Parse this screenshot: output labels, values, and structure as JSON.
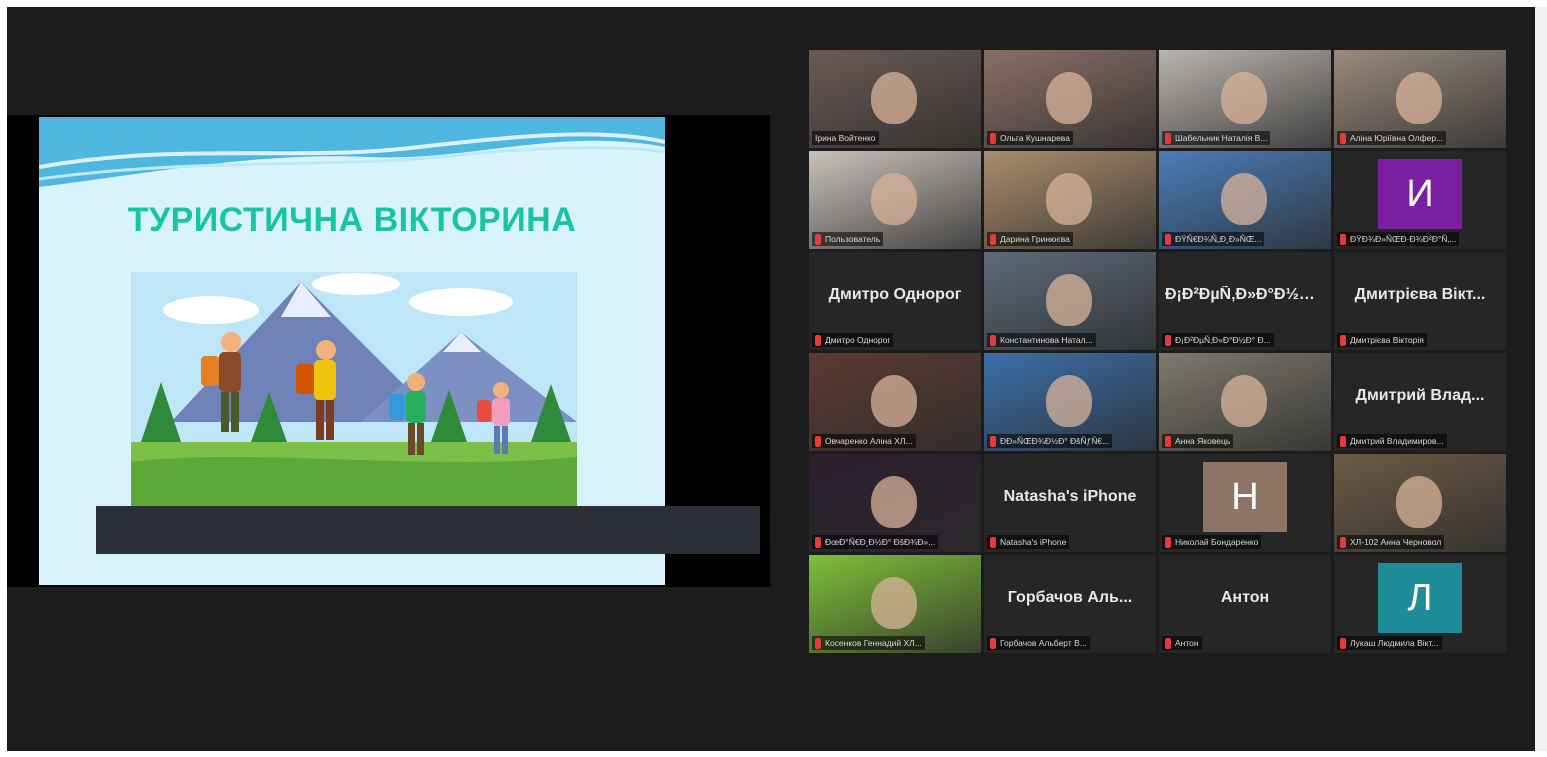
{
  "slide": {
    "title": "ТУРИСТИЧНА ВІКТОРИНА"
  },
  "participants": [
    {
      "label": "Ірина Войтенко",
      "muted": false,
      "active": true,
      "view": "video",
      "tone": "#6b5a55"
    },
    {
      "label": "Ольга Кушнарева",
      "muted": true,
      "view": "video",
      "tone": "#8a6f66"
    },
    {
      "label": "Шабельник Наталія В...",
      "muted": true,
      "view": "video",
      "tone": "#b9b4ae"
    },
    {
      "label": "Аліна Юріївна Олфер...",
      "muted": true,
      "view": "video",
      "tone": "#9a8a7c"
    },
    {
      "label": "Пользователь",
      "muted": true,
      "view": "video",
      "tone": "#c9c2bb"
    },
    {
      "label": "Дарина Гринюєва",
      "muted": true,
      "view": "video",
      "tone": "#a98d6d"
    },
    {
      "label": "ÐŸÑ€Ð¾Ñ„Ð¸Ð»ÑŒ...",
      "muted": true,
      "view": "video",
      "tone": "#4a7db8"
    },
    {
      "label": "ÐŸÐ¾Ð»ÑŒÐ·Ð¾Ð²Ð°Ñ‚...",
      "muted": true,
      "view": "avatar",
      "initial": "И",
      "avatar_color": "#7b1fa2"
    },
    {
      "label": "Дмитро Однорог",
      "muted": true,
      "view": "name",
      "display_name": "Дмитро Однорог"
    },
    {
      "label": "Константинова Натал...",
      "muted": true,
      "view": "video",
      "tone": "#5c6a78"
    },
    {
      "label": "Ð¡Ð²ÐµÑ‚Ð»Ð°Ð½Ð° Ð...",
      "muted": true,
      "view": "name",
      "display_name": "Ð¡Ð²ÐµÑ‚Ð»Ð°Ð½Ð° Ð..."
    },
    {
      "label": "Дмитрієва Вікторія",
      "muted": true,
      "view": "name",
      "display_name": "Дмитрієва Вікт..."
    },
    {
      "label": "Овчаренко Аліна ХЛ...",
      "muted": true,
      "view": "video",
      "tone": "#5b3b32"
    },
    {
      "label": "ÐÐ»ÑŒÐ¾Ð½Ð° ÐšÑƒÑ€...",
      "muted": true,
      "view": "video",
      "tone": "#3b6fa8"
    },
    {
      "label": "Анна Яковець",
      "muted": true,
      "view": "video",
      "tone": "#7d7a6c"
    },
    {
      "label": "Дмитрий Владимиров...",
      "muted": true,
      "view": "name",
      "display_name": "Дмитрий Влад..."
    },
    {
      "label": "ÐœÐ°Ñ€Ð¸Ð½Ð° ÐšÐ¾Ð»...",
      "muted": true,
      "view": "video",
      "tone": "#2a1f2d"
    },
    {
      "label": "Natasha's iPhone",
      "muted": true,
      "view": "name",
      "display_name": "Natasha's iPhone"
    },
    {
      "label": "Николай Бондаренко",
      "muted": true,
      "view": "avatar",
      "initial": "Н",
      "avatar_color": "#8d7465"
    },
    {
      "label": "ХЛ-102 Анна Черновол",
      "muted": true,
      "view": "video",
      "tone": "#6b5a45"
    },
    {
      "label": "Косенков Геннадий ХЛ...",
      "muted": true,
      "view": "video",
      "tone": "#7fbf3a"
    },
    {
      "label": "Горбачов Альберт В...",
      "muted": true,
      "view": "name",
      "display_name": "Горбачов Аль..."
    },
    {
      "label": "Антон",
      "muted": true,
      "view": "name",
      "display_name": "Антон"
    },
    {
      "label": "Лукаш Людмила Вікт...",
      "muted": true,
      "view": "avatar",
      "initial": "Л",
      "avatar_color": "#1e8c99"
    }
  ]
}
